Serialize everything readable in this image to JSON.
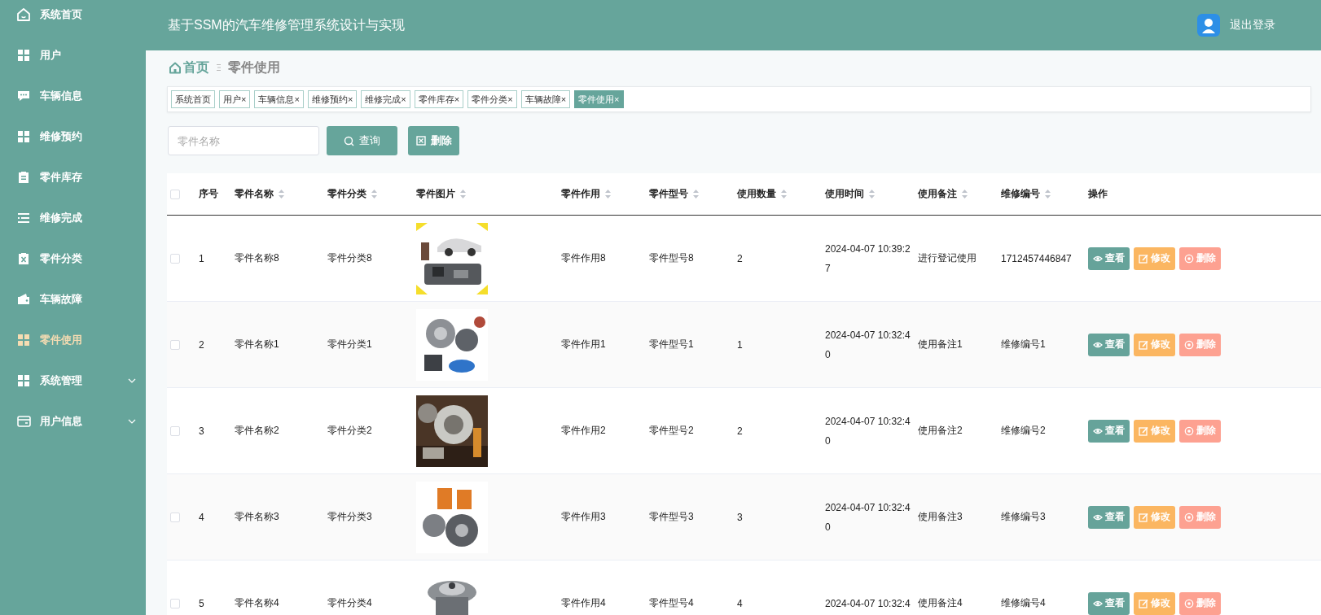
{
  "sidebar": {
    "items": [
      {
        "label": "系统首页",
        "selected": false
      },
      {
        "label": "用户",
        "selected": false
      },
      {
        "label": "车辆信息",
        "selected": false
      },
      {
        "label": "维修预约",
        "selected": false
      },
      {
        "label": "零件库存",
        "selected": false
      },
      {
        "label": "维修完成",
        "selected": false
      },
      {
        "label": "零件分类",
        "selected": false
      },
      {
        "label": "车辆故障",
        "selected": false
      },
      {
        "label": "零件使用",
        "selected": true
      },
      {
        "label": "系统管理",
        "selected": false,
        "expanded": false
      },
      {
        "label": "用户信息",
        "selected": false,
        "expanded": false
      }
    ]
  },
  "header": {
    "title": "基于SSM的汽车维修管理系统设计与实现",
    "logout": "退出登录"
  },
  "breadcrumb": {
    "home": "首页",
    "current": "零件使用"
  },
  "tags": [
    {
      "label": "系统首页",
      "selected": false
    },
    {
      "label": "用户",
      "close": "×",
      "selected": false
    },
    {
      "label": "车辆信息",
      "close": "×",
      "selected": false
    },
    {
      "label": "维修预约",
      "close": "×",
      "selected": false
    },
    {
      "label": "维修完成",
      "close": "×",
      "selected": false
    },
    {
      "label": "零件库存",
      "close": "×",
      "selected": false
    },
    {
      "label": "零件分类",
      "close": "×",
      "selected": false
    },
    {
      "label": "车辆故障",
      "close": "×",
      "selected": false
    },
    {
      "label": "零件使用",
      "close": "×",
      "selected": true
    }
  ],
  "search": {
    "placeholder": "零件名称",
    "query_button": "查询",
    "delete_button": "删除"
  },
  "table": {
    "header_checked": false,
    "columns": [
      {
        "label": "序号",
        "sortable": false
      },
      {
        "label": "零件名称",
        "sortable": true
      },
      {
        "label": "零件分类",
        "sortable": true
      },
      {
        "label": "零件图片",
        "sortable": true
      },
      {
        "label": "零件作用",
        "sortable": true
      },
      {
        "label": "零件型号",
        "sortable": true
      },
      {
        "label": "使用数量",
        "sortable": true
      },
      {
        "label": "使用时间",
        "sortable": true
      },
      {
        "label": "使用备注",
        "sortable": true
      },
      {
        "label": "维修编号",
        "sortable": true
      },
      {
        "label": "操作",
        "sortable": false
      }
    ],
    "rows": [
      {
        "checked": false,
        "index": "1",
        "name": "零件名称8",
        "category": "零件分类8",
        "usage": "零件作用8",
        "model": "零件型号8",
        "quantity": "2",
        "time": "2024-04-07 10:39:27",
        "note": "进行登记使用",
        "code": "1712457446847",
        "actions": [
          "查看",
          "修改",
          "删除"
        ]
      },
      {
        "checked": false,
        "index": "2",
        "name": "零件名称1",
        "category": "零件分类1",
        "usage": "零件作用1",
        "model": "零件型号1",
        "quantity": "1",
        "time": "2024-04-07 10:32:40",
        "note": "使用备注1",
        "code": "维修编号1",
        "actions": [
          "查看",
          "修改",
          "删除"
        ]
      },
      {
        "checked": false,
        "index": "3",
        "name": "零件名称2",
        "category": "零件分类2",
        "usage": "零件作用2",
        "model": "零件型号2",
        "quantity": "2",
        "time": "2024-04-07 10:32:40",
        "note": "使用备注2",
        "code": "维修编号2",
        "actions": [
          "查看",
          "修改",
          "删除"
        ]
      },
      {
        "checked": false,
        "index": "4",
        "name": "零件名称3",
        "category": "零件分类3",
        "usage": "零件作用3",
        "model": "零件型号3",
        "quantity": "3",
        "time": "2024-04-07 10:32:40",
        "note": "使用备注3",
        "code": "维修编号3",
        "actions": [
          "查看",
          "修改",
          "删除"
        ]
      },
      {
        "checked": false,
        "index": "5",
        "name": "零件名称4",
        "category": "零件分类4",
        "usage": "零件作用4",
        "model": "零件型号4",
        "quantity": "4",
        "time": "2024-04-07 10:32:4",
        "note": "使用备注4",
        "code": "维修编号4",
        "actions": [
          "查看",
          "修改",
          "删除"
        ]
      }
    ]
  }
}
